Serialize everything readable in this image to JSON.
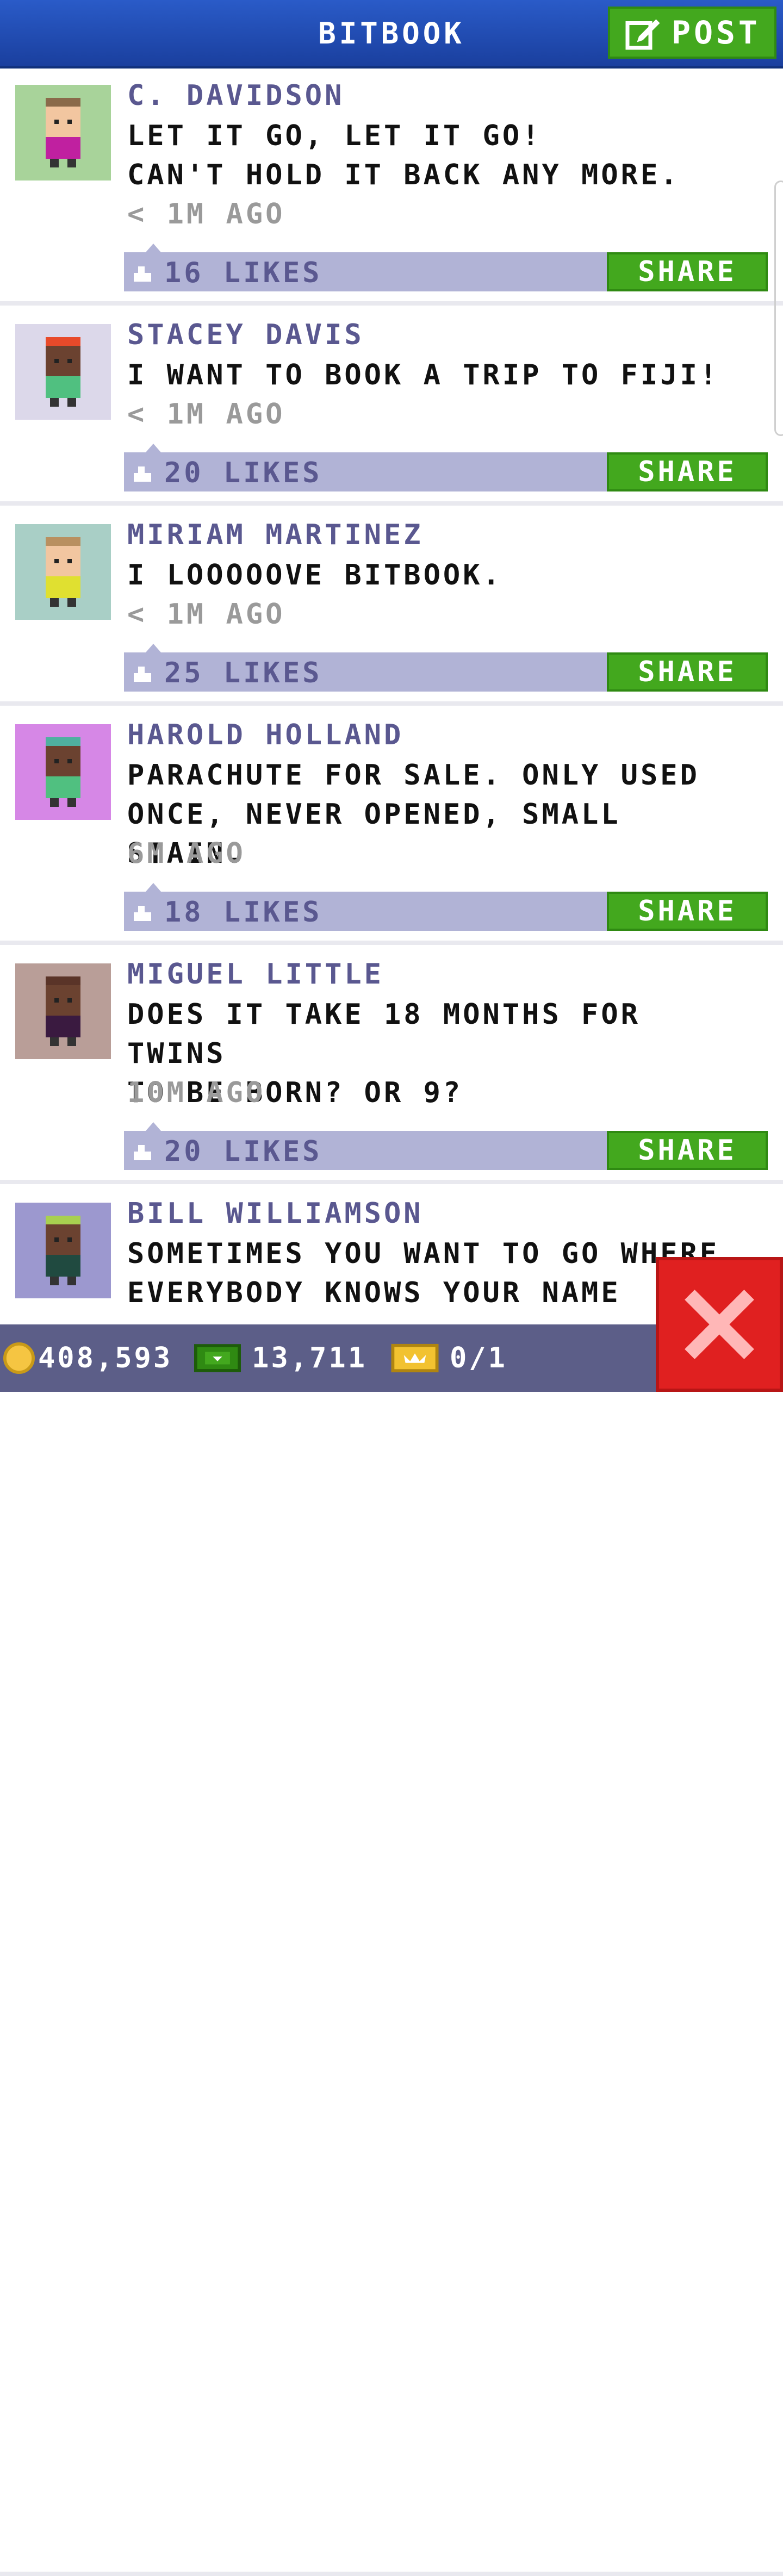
{
  "header": {
    "title": "BITBOOK",
    "post_label": "POST"
  },
  "posts": [
    {
      "author": "C. DAVIDSON",
      "lines": [
        "LET IT GO, LET IT GO!",
        "CAN'T HOLD IT BACK ANY MORE."
      ],
      "time": "< 1M AGO",
      "likes": "16 LIKES",
      "share_label": "SHARE",
      "avatar_bg": "#a8d39a"
    },
    {
      "author": "STACEY DAVIS",
      "lines": [
        "I WANT TO BOOK A TRIP TO FIJI!"
      ],
      "time": "< 1M AGO",
      "likes": "20 LIKES",
      "share_label": "SHARE",
      "avatar_bg": "#dcd8ea"
    },
    {
      "author": "MIRIAM MARTINEZ",
      "lines": [
        "I LOOOOOVE BITBOOK."
      ],
      "time": "< 1M AGO",
      "likes": "25 LIKES",
      "share_label": "SHARE",
      "avatar_bg": "#a9cfc6"
    },
    {
      "author": "HAROLD HOLLAND",
      "lines": [
        "PARACHUTE FOR SALE. ONLY USED",
        "ONCE, NEVER OPENED, SMALL STAIN."
      ],
      "time": "6M AGO",
      "likes": "18 LIKES",
      "share_label": "SHARE",
      "avatar_bg": "#d687e6"
    },
    {
      "author": "MIGUEL LITTLE",
      "lines": [
        "DOES IT TAKE 18 MONTHS FOR TWINS",
        "TO BE BORN? OR 9?"
      ],
      "time": "10M AGO",
      "likes": "20 LIKES",
      "share_label": "SHARE",
      "avatar_bg": "#b99e98"
    },
    {
      "author": "BILL WILLIAMSON",
      "lines": [
        "SOMETIMES YOU WANT TO GO WHERE",
        "EVERYBODY KNOWS YOUR NAME"
      ],
      "time": "",
      "likes": "",
      "share_label": "",
      "avatar_bg": "#9c98cf"
    }
  ],
  "status": {
    "coins": "408,593",
    "bux": "13,711",
    "tickets": "0/1"
  },
  "colors": {
    "header_blue": "#1f47ad",
    "action_green": "#43a81e",
    "likes_bar": "#b1b3d6",
    "close_red": "#e02020"
  }
}
